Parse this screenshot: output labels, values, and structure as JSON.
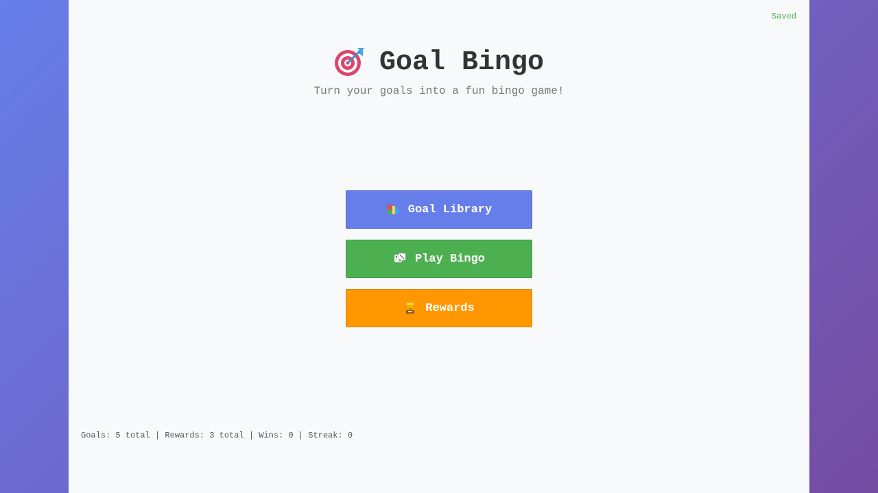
{
  "status": {
    "saved_label": "Saved"
  },
  "header": {
    "title": "Goal Bingo",
    "subtitle": "Turn your goals into a fun bingo game!",
    "icon": "target-dart-icon"
  },
  "menu": {
    "items": [
      {
        "label": "Goal Library",
        "icon": "books-icon",
        "color": "#667eea"
      },
      {
        "label": "Play Bingo",
        "icon": "dice-icon",
        "color": "#4caf50"
      },
      {
        "label": "Rewards",
        "icon": "trophy-icon",
        "color": "#ff9800"
      }
    ]
  },
  "stats": {
    "text": "Goals: 5 total | Rewards: 3 total | Wins: 0 | Streak: 0"
  },
  "colors": {
    "background_gradient_start": "#667eea",
    "background_gradient_end": "#764ba2",
    "panel": "#f8f9fa",
    "saved": "#4caf50"
  }
}
